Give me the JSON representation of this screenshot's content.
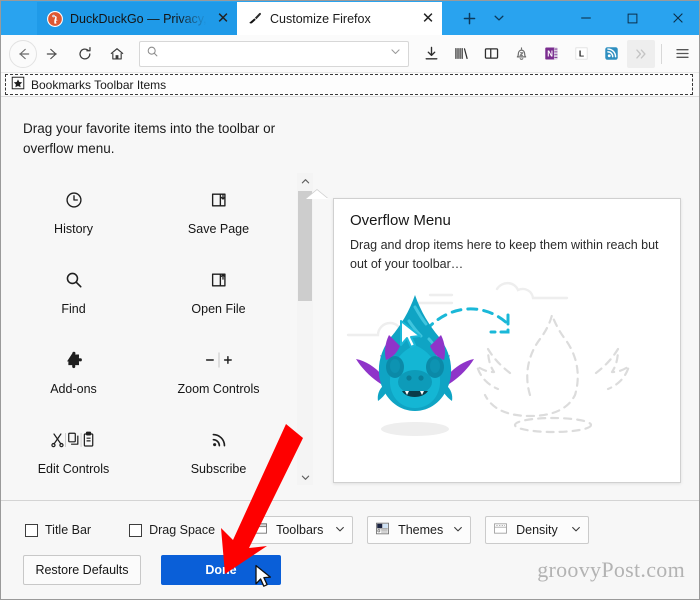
{
  "window": {
    "titlebar_color": "#29a3ef",
    "accent_color": "#0a5fd8",
    "tabs": [
      {
        "title": "DuckDuckGo — Privacy, sim",
        "favicon": "duckduckgo-icon",
        "active": false,
        "close_label": "✕"
      },
      {
        "title": "Customize Firefox",
        "favicon": "paintbrush-icon",
        "active": true,
        "close_label": "✕"
      }
    ],
    "new_tab_label": "+",
    "tab_list_label": "⌄",
    "minimize_label": "–",
    "maximize_label": "□",
    "close_label": "✕"
  },
  "navbar": {
    "back_label": "←",
    "forward_label": "→",
    "reload_label": "↻",
    "home_label": "home-icon",
    "urlbar": {
      "value": "",
      "placeholder": ""
    },
    "icons": [
      {
        "name": "downloads-icon",
        "label": ""
      },
      {
        "name": "library-icon",
        "label": ""
      },
      {
        "name": "sidebar-icon",
        "label": ""
      },
      {
        "name": "notifications-snoozed-icon",
        "label": ""
      },
      {
        "name": "onenote-icon",
        "label": "N"
      },
      {
        "name": "lastpass-icon",
        "label": "L"
      },
      {
        "name": "feed-reader-icon",
        "label": ""
      },
      {
        "name": "overflow-icon",
        "label": "»"
      },
      {
        "name": "app-menu-icon",
        "label": ""
      }
    ]
  },
  "bookmarks_toolbar": {
    "item_label": "Bookmarks Toolbar Items",
    "item_icon": "bookmark-star-icon"
  },
  "customize": {
    "hint": "Drag your favorite items into the toolbar or overflow menu.",
    "palette": [
      {
        "label": "History",
        "icon": "clock-icon"
      },
      {
        "label": "Save Page",
        "icon": "save-page-icon"
      },
      {
        "label": "Find",
        "icon": "magnifier-icon"
      },
      {
        "label": "Open File",
        "icon": "open-file-icon"
      },
      {
        "label": "Add-ons",
        "icon": "puzzle-piece-icon"
      },
      {
        "label": "Zoom Controls",
        "icon": "zoom-controls-icon"
      },
      {
        "label": "Edit Controls",
        "icon": "edit-controls-icon"
      },
      {
        "label": "Subscribe",
        "icon": "rss-icon"
      }
    ],
    "overflow_panel": {
      "title": "Overflow Menu",
      "description": "Drag and drop items here to keep them within reach but out of your toolbar…",
      "illustration": "firefox-dino-drag-illustration"
    }
  },
  "bottom_bar": {
    "checkboxes": [
      {
        "label": "Title Bar",
        "checked": false
      },
      {
        "label": "Drag Space",
        "checked": false
      }
    ],
    "dropdowns": [
      {
        "label": "Toolbars",
        "icon": "toolbars-icon",
        "caret": "⌄"
      },
      {
        "label": "Themes",
        "icon": "themes-icon",
        "caret": "⌄"
      },
      {
        "label": "Density",
        "icon": "density-icon",
        "caret": "⌄"
      }
    ],
    "restore_defaults_label": "Restore Defaults",
    "done_label": "Done"
  },
  "watermark": {
    "text": "groovyPost.com"
  }
}
